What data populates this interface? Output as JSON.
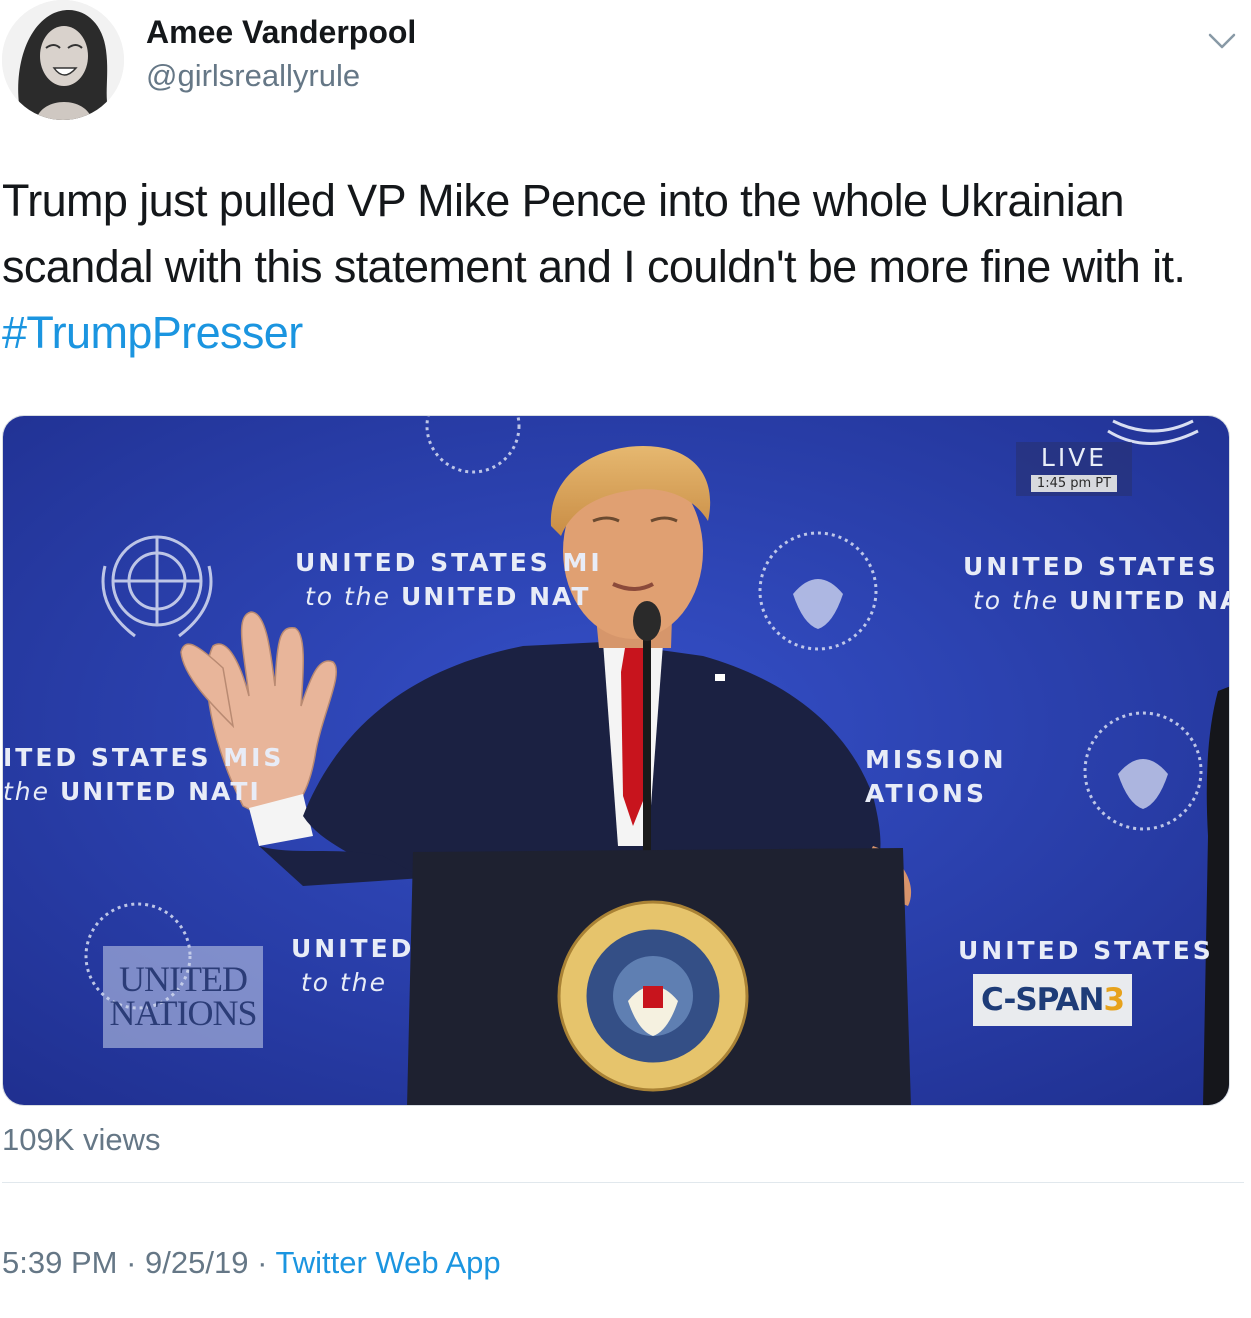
{
  "author": {
    "name": "Amee Vanderpool",
    "handle": "@girlsreallyrule"
  },
  "tweet": {
    "text": "Trump just pulled VP Mike Pence into the whole Ukrainian scandal with this statement and I couldn't be more fine with it.",
    "hashtag": "#TrumpPresser"
  },
  "video": {
    "live_label": "LIVE",
    "live_time": "1:45 pm PT",
    "network": "C-SPAN",
    "network_number": "3",
    "backdrop_line1": "UNITED STATES MI",
    "backdrop_line2_italic": "to the",
    "backdrop_line2_bold": "UNITED NAT",
    "backdrop_right_line1": "UNITED STATES MI",
    "backdrop_right_line2_bold": "UNITED NA",
    "backdrop_left_line1": "ITED STATES MIS",
    "backdrop_left_line2_italic": "the",
    "backdrop_left_line2_bold": "UNITED NATI",
    "backdrop_mid_line1": "MISSION",
    "backdrop_mid_line2": "ATIONS",
    "backdrop_low_line1": "UNITED",
    "backdrop_low_line2_italic": "to the",
    "backdrop_low_right_line1": "UNITED STATES",
    "un_text_line1": "UNITED",
    "un_text_line2": "NATIONS"
  },
  "stats": {
    "views": "109K views"
  },
  "meta": {
    "time": "5:39 PM",
    "separator": "·",
    "date": "9/25/19",
    "source": "Twitter Web App"
  },
  "colors": {
    "link": "#1b95e0",
    "secondary_text": "#657786",
    "primary_text": "#14171a",
    "backdrop_blue": "#2a3fb0"
  },
  "icons": {
    "menu": "chevron-down-icon"
  }
}
